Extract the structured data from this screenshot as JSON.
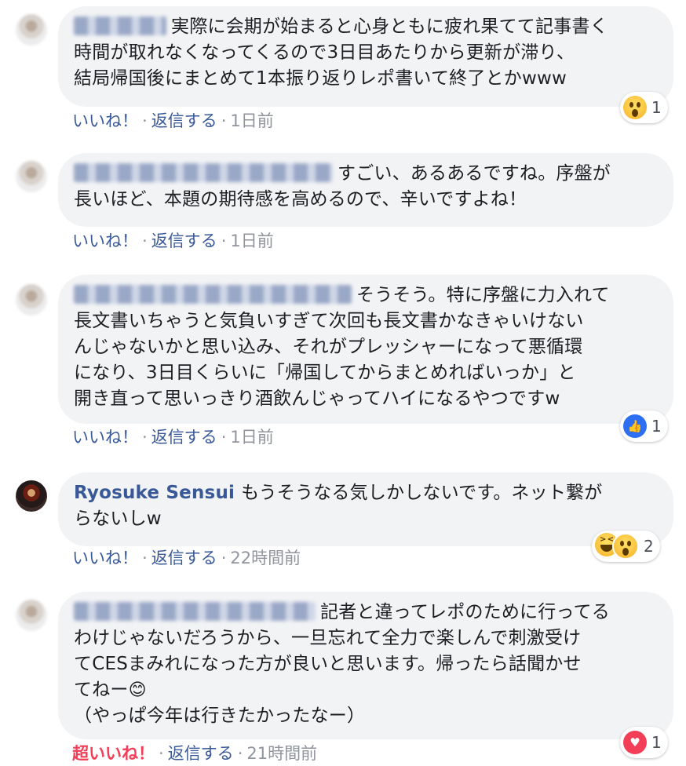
{
  "comments": [
    {
      "author": "",
      "text_lines": [
        "実際に会期が始まると心身ともに疲れ果てて記事書く",
        "時間が取れなくなってくるので3日目あたりから更新が滞り、",
        "結局帰国後にまとめて1本振り返りレポ書いて終了とかwww"
      ],
      "actions": {
        "like": "いいね！",
        "reply": "返信する",
        "time": "1日前"
      },
      "reaction": {
        "icons": [
          "wow-icon"
        ],
        "count": "1"
      }
    },
    {
      "author": "",
      "text_lines": [
        "すごい、あるあるですね。序盤が",
        "長いほど、本題の期待感を高めるので、辛いですよね！"
      ],
      "actions": {
        "like": "いいね！",
        "reply": "返信する",
        "time": "1日前"
      }
    },
    {
      "author": "",
      "text_lines": [
        "そうそう。特に序盤に力入れて",
        "長文書いちゃうと気負いすぎて次回も長文書かなきゃいけない",
        "んじゃないかと思い込み、それがプレッシャーになって悪循環",
        "になり、3日目くらいに「帰国してからまとめればいっか」と",
        "開き直って思いっきり酒飲んじゃってハイになるやつですw"
      ],
      "actions": {
        "like": "いいね！",
        "reply": "返信する",
        "time": "1日前"
      },
      "reaction": {
        "icons": [
          "like-icon"
        ],
        "count": "1"
      }
    },
    {
      "author": "Ryosuke Sensui",
      "text_lines": [
        "もうそうなる気しかしないです。ネット繋が",
        "らないしw"
      ],
      "actions": {
        "like": "いいね！",
        "reply": "返信する",
        "time": "22時間前"
      },
      "reaction": {
        "icons": [
          "haha-icon",
          "wow-icon"
        ],
        "count": "2"
      }
    },
    {
      "author": "",
      "text_lines": [
        "記者と違ってレポのために行ってる",
        "わけじゃないだろうから、一旦忘れて全力で楽しんで刺激受け",
        "てCESまみれになった方が良いと思います。帰ったら話聞かせ",
        "てねー",
        "（やっぱ今年は行きたかったなー）"
      ],
      "emoji": "😊",
      "actions": {
        "like": "超いいね！",
        "reply": "返信する",
        "time": "21時間前"
      },
      "reaction": {
        "icons": [
          "love-icon"
        ],
        "count": "1"
      }
    }
  ],
  "colors": {
    "name": "#385898",
    "bubble": "#f2f3f5",
    "love": "#f33e58",
    "meta": "#90949c"
  }
}
